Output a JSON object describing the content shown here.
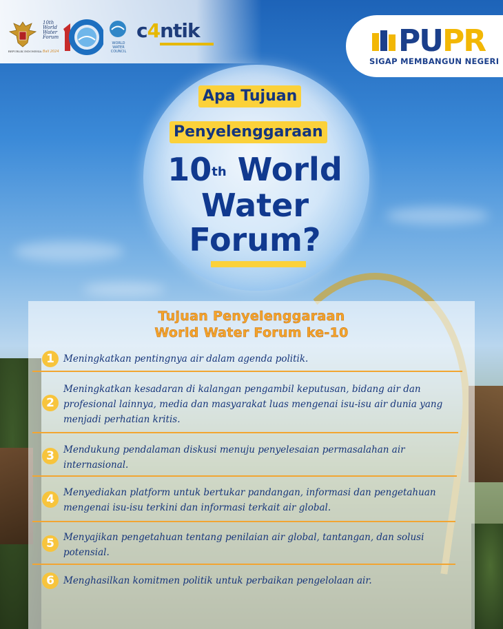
{
  "header": {
    "garuda_caption": "REPUBLIK INDONESIA",
    "wwf_logo_lines": [
      "10th",
      "World",
      "Water",
      "Forum"
    ],
    "wwf_location": "Bali 2024",
    "wwc_lines": [
      "WORLD",
      "WATER",
      "COUNCIL"
    ],
    "cantik_prefix": "c",
    "cantik_four": "4",
    "cantik_suffix": "ntik",
    "pupr_word_main": "PU",
    "pupr_word_accent": "PR",
    "pupr_tagline": "SIGAP MEMBANGUN NEGERI"
  },
  "hero": {
    "line1": "Apa Tujuan",
    "line2": "Penyelenggaraan",
    "big_number": "10",
    "big_sup": "th",
    "big_word1": "World",
    "big_line2": "Water",
    "big_line3": "Forum?"
  },
  "panel": {
    "title_line1": "Tujuan Penyelenggaraan",
    "title_line2": "World Water Forum ke-10",
    "items": [
      {
        "num": "1",
        "text": "Meningkatkan pentingnya air dalam agenda politik."
      },
      {
        "num": "2",
        "text": "Meningkatkan kesadaran di kalangan pengambil keputusan, bidang air dan profesional lainnya, media dan masyarakat luas mengenai isu-isu air dunia yang menjadi perhatian kritis."
      },
      {
        "num": "3",
        "text": "Mendukung pendalaman diskusi menuju penyelesaian permasalahan air internasional."
      },
      {
        "num": "4",
        "text": "Menyediakan platform untuk bertukar pandangan, informasi dan pengetahuan mengenai isu-isu terkini dan informasi terkait air global."
      },
      {
        "num": "5",
        "text": "Menyajikan pengetahuan tentang penilaian air global, tantangan, dan solusi potensial."
      },
      {
        "num": "6",
        "text": "Menghasilkan komitmen politik untuk perbaikan pengelolaan air."
      }
    ]
  },
  "colors": {
    "navy": "#16357a",
    "yellow": "#fbd13a",
    "orange": "#f2a531"
  }
}
